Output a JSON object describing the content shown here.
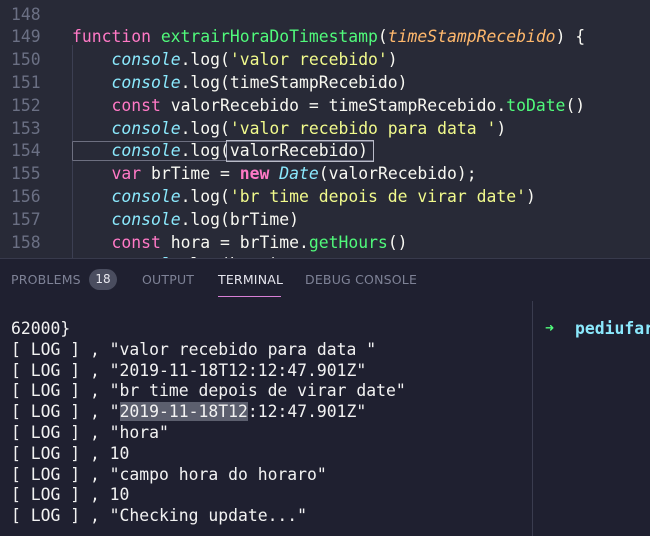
{
  "editor": {
    "lines": [
      {
        "num": "148",
        "tokens": []
      },
      {
        "num": "149",
        "tokens": [
          {
            "t": "function ",
            "c": "t-kw"
          },
          {
            "t": "extrairHoraDoTimestamp",
            "c": "t-fn"
          },
          {
            "t": "(",
            "c": "t-plain"
          },
          {
            "t": "timeStampRecebido",
            "c": "t-param"
          },
          {
            "t": ") {",
            "c": "t-plain"
          }
        ]
      },
      {
        "num": "150",
        "tokens": [
          {
            "t": "    ",
            "c": "t-plain"
          },
          {
            "t": "console",
            "c": "t-obj"
          },
          {
            "t": ".log(",
            "c": "t-plain"
          },
          {
            "t": "'valor recebido'",
            "c": "t-str"
          },
          {
            "t": ")",
            "c": "t-plain"
          }
        ]
      },
      {
        "num": "151",
        "tokens": [
          {
            "t": "    ",
            "c": "t-plain"
          },
          {
            "t": "console",
            "c": "t-obj"
          },
          {
            "t": ".log(timeStampRecebido)",
            "c": "t-plain"
          }
        ]
      },
      {
        "num": "152",
        "tokens": [
          {
            "t": "    ",
            "c": "t-plain"
          },
          {
            "t": "const",
            "c": "t-kw"
          },
          {
            "t": " valorRecebido = timeStampRecebido.",
            "c": "t-plain"
          },
          {
            "t": "toDate",
            "c": "t-fn"
          },
          {
            "t": "()",
            "c": "t-plain"
          }
        ]
      },
      {
        "num": "153",
        "tokens": [
          {
            "t": "    ",
            "c": "t-plain"
          },
          {
            "t": "console",
            "c": "t-obj"
          },
          {
            "t": ".log(",
            "c": "t-plain"
          },
          {
            "t": "'valor recebido para data '",
            "c": "t-str"
          },
          {
            "t": ")",
            "c": "t-plain"
          }
        ]
      },
      {
        "num": "154",
        "tokens": [
          {
            "t": "    ",
            "c": "t-plain"
          },
          {
            "t": "console",
            "c": "t-obj"
          },
          {
            "t": ".log(valorRecebido)",
            "c": "t-plain"
          }
        ]
      },
      {
        "num": "155",
        "tokens": [
          {
            "t": "    ",
            "c": "t-plain"
          },
          {
            "t": "var",
            "c": "t-kw"
          },
          {
            "t": " brTime = ",
            "c": "t-plain"
          },
          {
            "t": "new",
            "c": "t-new"
          },
          {
            "t": " ",
            "c": "t-plain"
          },
          {
            "t": "Date",
            "c": "t-cls"
          },
          {
            "t": "(valorRecebido);",
            "c": "t-plain"
          }
        ]
      },
      {
        "num": "156",
        "tokens": [
          {
            "t": "    ",
            "c": "t-plain"
          },
          {
            "t": "console",
            "c": "t-obj"
          },
          {
            "t": ".log(",
            "c": "t-plain"
          },
          {
            "t": "'br time depois de virar date'",
            "c": "t-str"
          },
          {
            "t": ")",
            "c": "t-plain"
          }
        ]
      },
      {
        "num": "157",
        "tokens": [
          {
            "t": "    ",
            "c": "t-plain"
          },
          {
            "t": "console",
            "c": "t-obj"
          },
          {
            "t": ".log(brTime)",
            "c": "t-plain"
          }
        ]
      },
      {
        "num": "158",
        "tokens": [
          {
            "t": "    ",
            "c": "t-plain"
          },
          {
            "t": "const",
            "c": "t-kw"
          },
          {
            "t": " hora = brTime.",
            "c": "t-plain"
          },
          {
            "t": "getHours",
            "c": "t-fn"
          },
          {
            "t": "()",
            "c": "t-plain"
          }
        ]
      },
      {
        "num": "",
        "tokens": [
          {
            "t": "    ",
            "c": "t-plain"
          },
          {
            "t": "console",
            "c": "t-obj"
          },
          {
            "t": ".log(hora)",
            "c": "t-plain"
          }
        ]
      }
    ]
  },
  "panel": {
    "tabs": {
      "problems": "PROBLEMS",
      "problems_count": "18",
      "output": "OUTPUT",
      "terminal": "TERMINAL",
      "debug_console": "DEBUG CONSOLE"
    },
    "terminal": {
      "lines": [
        "62000}",
        "[ LOG ] , \"valor recebido para data \"",
        "[ LOG ] , \"2019-11-18T12:12:47.901Z\"",
        "[ LOG ] , \"br time depois de virar date\"",
        "[ LOG ] , \"2019-11-18T12:12:47.901Z\"",
        "[ LOG ] , \"hora\"",
        "[ LOG ] , 10",
        "[ LOG ] , \"campo hora do horaro\"",
        "[ LOG ] , 10",
        "[ LOG ] , \"Checking update...\""
      ],
      "selection": {
        "line": 4,
        "text": "2019-11-18T12"
      },
      "prompt_arrow": "➜",
      "prompt_dir": "pediufar"
    }
  },
  "colors": {
    "keyword": "#ff79c6",
    "function": "#50fa7b",
    "string": "#f1fa8c",
    "param": "#ffb86c",
    "builtin": "#8be9fd",
    "tab_active_underline": "#d87fd6"
  }
}
